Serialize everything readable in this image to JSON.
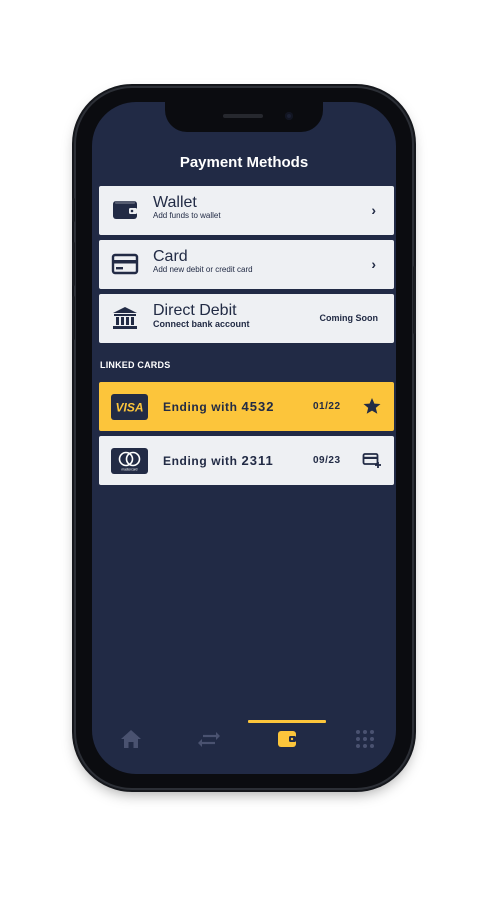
{
  "screen": {
    "title": "Payment Methods"
  },
  "menu": [
    {
      "icon": "wallet-icon",
      "title": "Wallet",
      "subtitle": "Add funds to wallet",
      "trailing": "chevron"
    },
    {
      "icon": "credit-card-icon",
      "title": "Card",
      "subtitle": "Add new debit or credit card",
      "trailing": "chevron"
    },
    {
      "icon": "bank-icon",
      "title": "Direct Debit",
      "subtitle": "Connect bank account",
      "trailing_text": "Coming Soon"
    }
  ],
  "linked_cards": {
    "heading": "LINKED CARDS",
    "cards": [
      {
        "brand": "VISA",
        "logo_icon": "visa-logo",
        "prefix": "Ending with",
        "last4": "4532",
        "expiry": "01/22",
        "action_icon": "star-icon",
        "highlighted": true
      },
      {
        "brand": "mastercard",
        "logo_icon": "mastercard-logo",
        "prefix": "Ending with",
        "last4": "2311",
        "expiry": "09/23",
        "action_icon": "card-add-icon",
        "highlighted": false
      }
    ]
  },
  "tabbar": {
    "active_index": 2,
    "tabs": [
      {
        "icon": "home-icon"
      },
      {
        "icon": "transfer-icon"
      },
      {
        "icon": "wallet-icon"
      },
      {
        "icon": "grid-menu-icon"
      }
    ]
  },
  "colors": {
    "background": "#212a45",
    "accent": "#fcc53b",
    "card": "#eef0f3",
    "text_dark": "#222b45",
    "tab_inactive": "#4a5270"
  }
}
